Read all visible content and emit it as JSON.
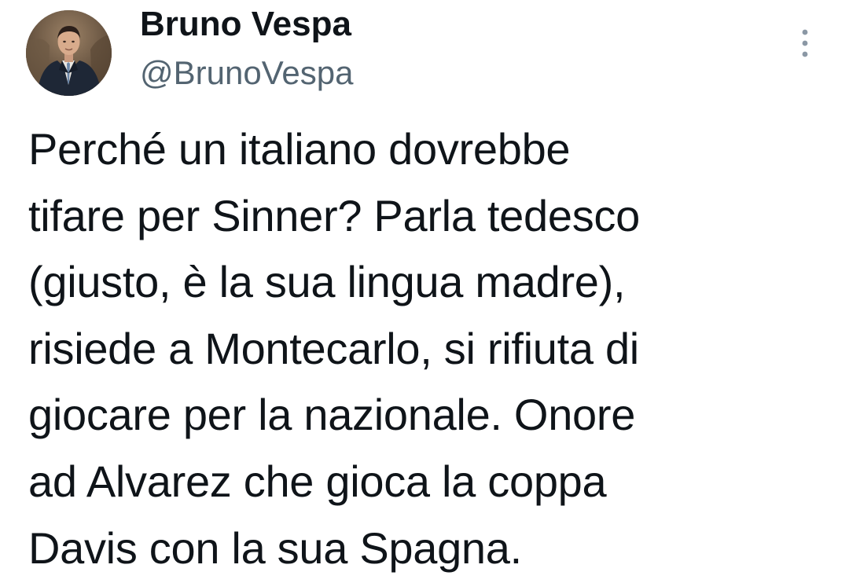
{
  "tweet": {
    "author": {
      "display_name": "Bruno Vespa",
      "handle": "@BrunoVespa",
      "avatar_icon": "profile-photo"
    },
    "more_icon": "more-vertical-icon",
    "text_lines": [
      "Perché un italiano dovrebbe",
      "tifare per Sinner? Parla tedesco",
      "(giusto, è la sua lingua madre),",
      "risiede a Montecarlo, si rifiuta di",
      "giocare per la nazionale. Onore",
      "ad Alvarez che gioca la coppa",
      "Davis con la sua Spagna."
    ]
  },
  "colors": {
    "background": "#ffffff",
    "primary_text": "#0f1419",
    "secondary_text": "#536471",
    "icon": "#8b98a5"
  }
}
